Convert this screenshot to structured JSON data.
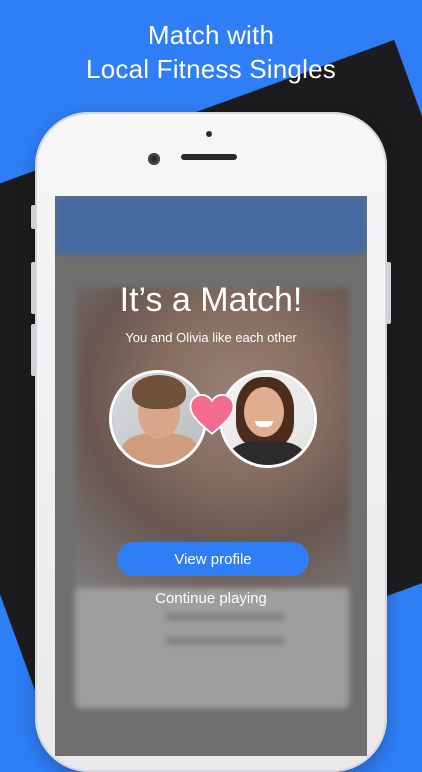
{
  "headline": {
    "line1": "Match with",
    "line2": "Local Fitness Singles"
  },
  "match": {
    "title": "It’s a Match!",
    "subtitle": "You and Olivia like each other",
    "view_profile_label": "View profile",
    "continue_label": "Continue playing"
  },
  "colors": {
    "brand_blue": "#2f7ef5",
    "heart_pink": "#f36b8f",
    "dark_band": "#1c1c1e"
  },
  "icons": {
    "heart": "heart-icon"
  }
}
